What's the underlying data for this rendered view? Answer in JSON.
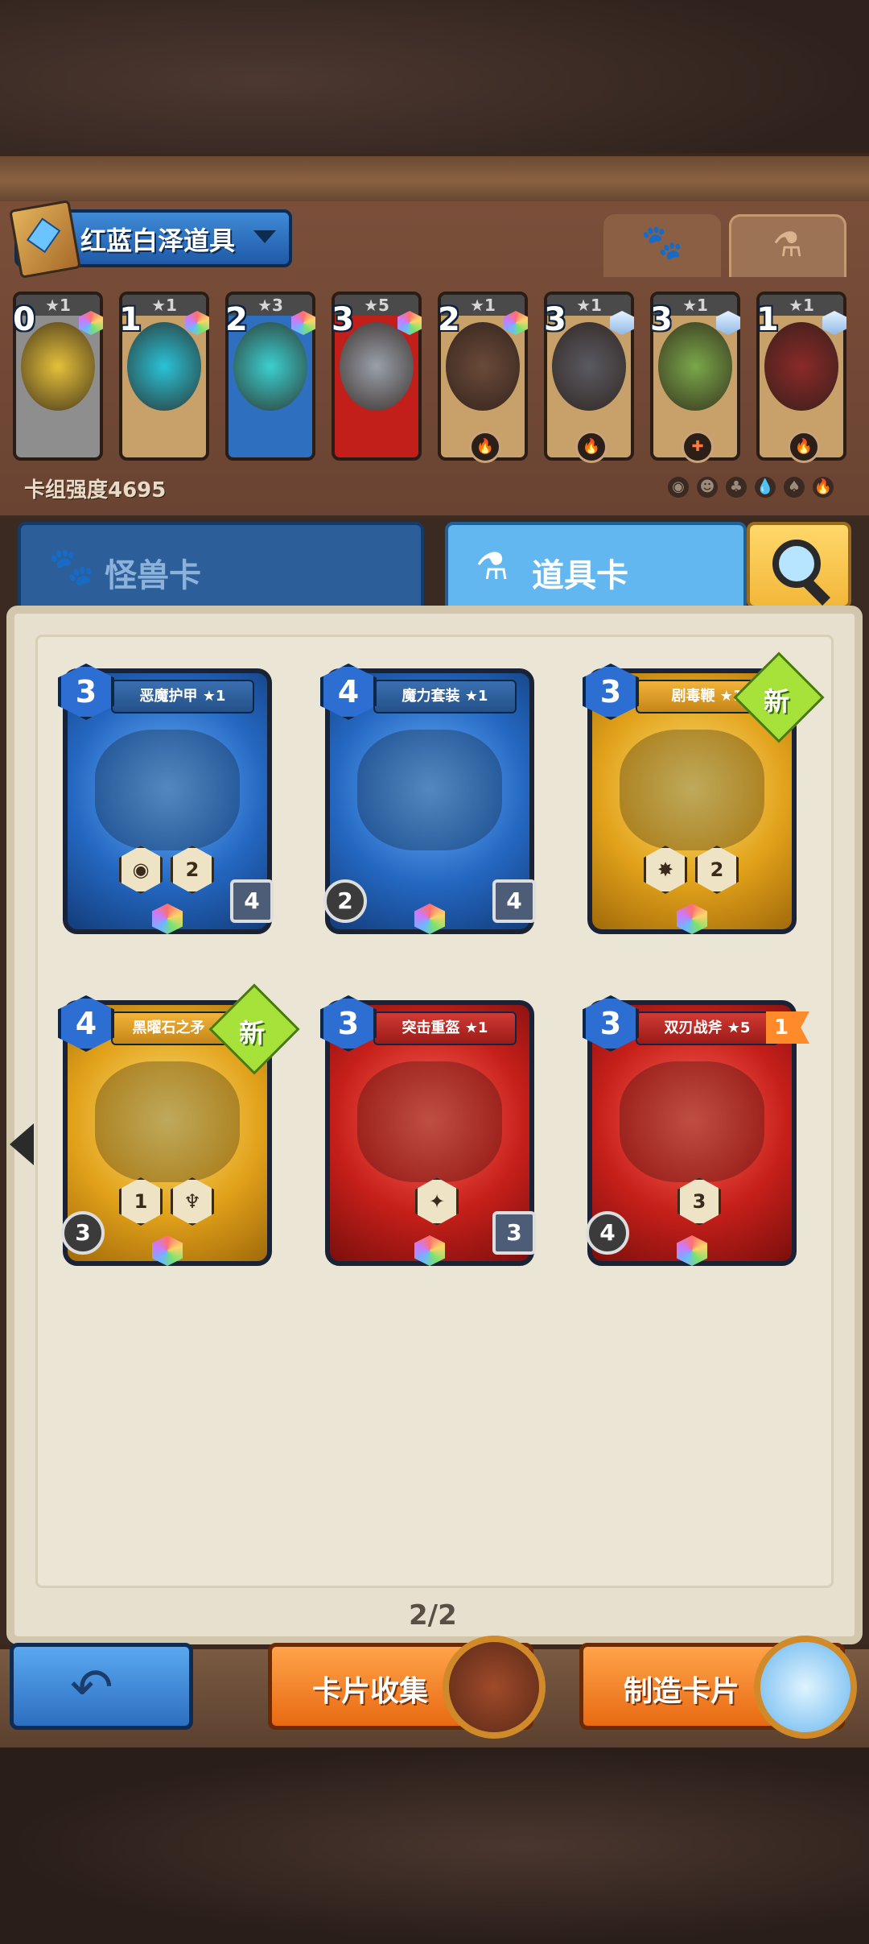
{
  "deck": {
    "title": "红蓝白泽道具",
    "strength": "卡组强度4695",
    "slots": [
      {
        "cost": "0",
        "stars": "★1",
        "color": "#8e8e8e",
        "art": "#e4c13a",
        "gem": "rainbow",
        "badge": ""
      },
      {
        "cost": "1",
        "stars": "★1",
        "color": "#c8a06a",
        "art": "#2ac3d8",
        "gem": "rainbow",
        "badge": ""
      },
      {
        "cost": "2",
        "stars": "★3",
        "color": "#2e6fc0",
        "art": "#3bd0d0",
        "gem": "rainbow",
        "badge": ""
      },
      {
        "cost": "3",
        "stars": "★5",
        "color": "#c21e1a",
        "art": "#9aa0aa",
        "gem": "rainbow",
        "badge": ""
      },
      {
        "cost": "2",
        "stars": "★1",
        "color": "#c8a06a",
        "art": "#6a4a3a",
        "gem": "rainbow",
        "badge": "🔥"
      },
      {
        "cost": "3",
        "stars": "★1",
        "color": "#c8a06a",
        "art": "#5a5a62",
        "gem": "blue",
        "badge": "🔥"
      },
      {
        "cost": "3",
        "stars": "★1",
        "color": "#c8a06a",
        "art": "#7aa84a",
        "gem": "blue",
        "badge": "✚"
      },
      {
        "cost": "1",
        "stars": "★1",
        "color": "#c8a06a",
        "art": "#8a2a2a",
        "gem": "blue",
        "badge": "🔥"
      }
    ]
  },
  "tabs": {
    "monster": "怪兽卡",
    "item": "道具卡"
  },
  "cards": [
    {
      "name": "恶魔护甲 ★1",
      "cost": "3",
      "theme": "blue",
      "left": "",
      "right": "4",
      "skills": [
        "◉",
        "2"
      ],
      "new": ""
    },
    {
      "name": "魔力套装 ★1",
      "cost": "4",
      "theme": "blue",
      "left": "2",
      "right": "4",
      "skills": [],
      "new": ""
    },
    {
      "name": "剧毒鞭 ★1",
      "cost": "3",
      "theme": "yellow",
      "left": "",
      "right": "",
      "skills": [
        "✸",
        "2"
      ],
      "new": "新"
    },
    {
      "name": "黑曜石之矛 ★1",
      "cost": "4",
      "theme": "yellow",
      "left": "3",
      "right": "",
      "skills": [
        "1",
        "♆"
      ],
      "new": "新"
    },
    {
      "name": "突击重盔 ★1",
      "cost": "3",
      "theme": "red",
      "left": "",
      "right": "3",
      "skills": [
        "✦"
      ],
      "new": ""
    },
    {
      "name": "双刃战斧 ★5",
      "cost": "3",
      "theme": "red",
      "left": "4",
      "right": "",
      "skills": [
        "3"
      ],
      "new": "",
      "level": "1"
    }
  ],
  "pagination": "2/2",
  "buttons": {
    "collection": "卡片收集",
    "craft": "制造卡片"
  }
}
